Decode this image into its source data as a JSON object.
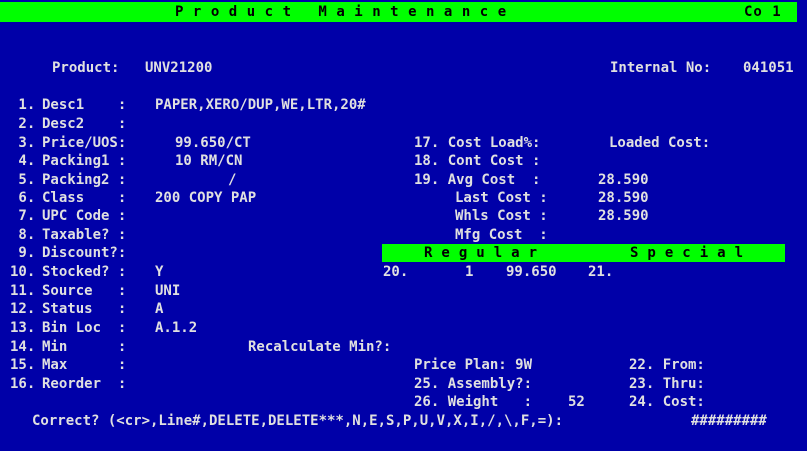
{
  "header": {
    "title": "Product Maintenance",
    "company": "Co 1",
    "product_label": "Product:",
    "product_value": "UNV21200",
    "internal_label": "Internal No:",
    "internal_value": "041051"
  },
  "left_fields": [
    {
      "num": " 1.",
      "label": "Desc1    :",
      "value": "PAPER,XERO/DUP,WE,LTR,20#"
    },
    {
      "num": " 2.",
      "label": "Desc2    :",
      "value": ""
    },
    {
      "num": " 3.",
      "label": "Price/UOS:",
      "value": "99.650/CT"
    },
    {
      "num": " 4.",
      "label": "Packing1 :",
      "value": "10 RM/CN"
    },
    {
      "num": " 5.",
      "label": "Packing2 :",
      "value": "/"
    },
    {
      "num": " 6.",
      "label": "Class    :",
      "value": "200 COPY PAP"
    },
    {
      "num": " 7.",
      "label": "UPC Code :",
      "value": ""
    },
    {
      "num": " 8.",
      "label": "Taxable? :",
      "value": ""
    },
    {
      "num": " 9.",
      "label": "Discount?:",
      "value": ""
    },
    {
      "num": "10.",
      "label": "Stocked? :",
      "value": "Y"
    },
    {
      "num": "11.",
      "label": "Source   :",
      "value": "UNI"
    },
    {
      "num": "12.",
      "label": "Status   :",
      "value": "A"
    },
    {
      "num": "13.",
      "label": "Bin Loc  :",
      "value": "A.1.2"
    },
    {
      "num": "14.",
      "label": "Min      :",
      "value": ""
    },
    {
      "num": "15.",
      "label": "Max      :",
      "value": ""
    },
    {
      "num": "16.",
      "label": "Reorder  :",
      "value": ""
    }
  ],
  "recalc_label": "Recalculate Min?:",
  "costs": {
    "cost_load": "17. Cost Load%:",
    "loaded_cost": "Loaded Cost:",
    "cont_cost": "18. Cont Cost :",
    "avg_cost_label": "19. Avg Cost  :",
    "avg_cost_value": "28.590",
    "last_cost_label": "Last Cost :",
    "last_cost_value": "28.590",
    "whls_cost_label": "Whls Cost :",
    "whls_cost_value": "28.590",
    "mfg_cost_label": "Mfg Cost  :"
  },
  "pricing_bar": {
    "regular": "Regular",
    "special": "Special"
  },
  "pricing_row": {
    "reg_num": "20.",
    "reg_qty": "1",
    "reg_price": "99.650",
    "spec_num": "21."
  },
  "bottom_right": {
    "price_plan": "Price Plan: 9W",
    "from": "22. From:",
    "assembly": "25. Assembly?:",
    "thru": "23. Thru:",
    "weight_label": "26. Weight   :",
    "weight_value": "52",
    "cost": "24. Cost:"
  },
  "prompt": "Correct? (<cr>,Line#,DELETE,DELETE***,N,E,S,P,U,V,X,I,/,\\,F,=):",
  "input_value": "#########",
  "colors": {
    "background": "#0000a8",
    "text": "#e0e0e0",
    "bar": "#00ff00",
    "bar_text": "#000000"
  }
}
